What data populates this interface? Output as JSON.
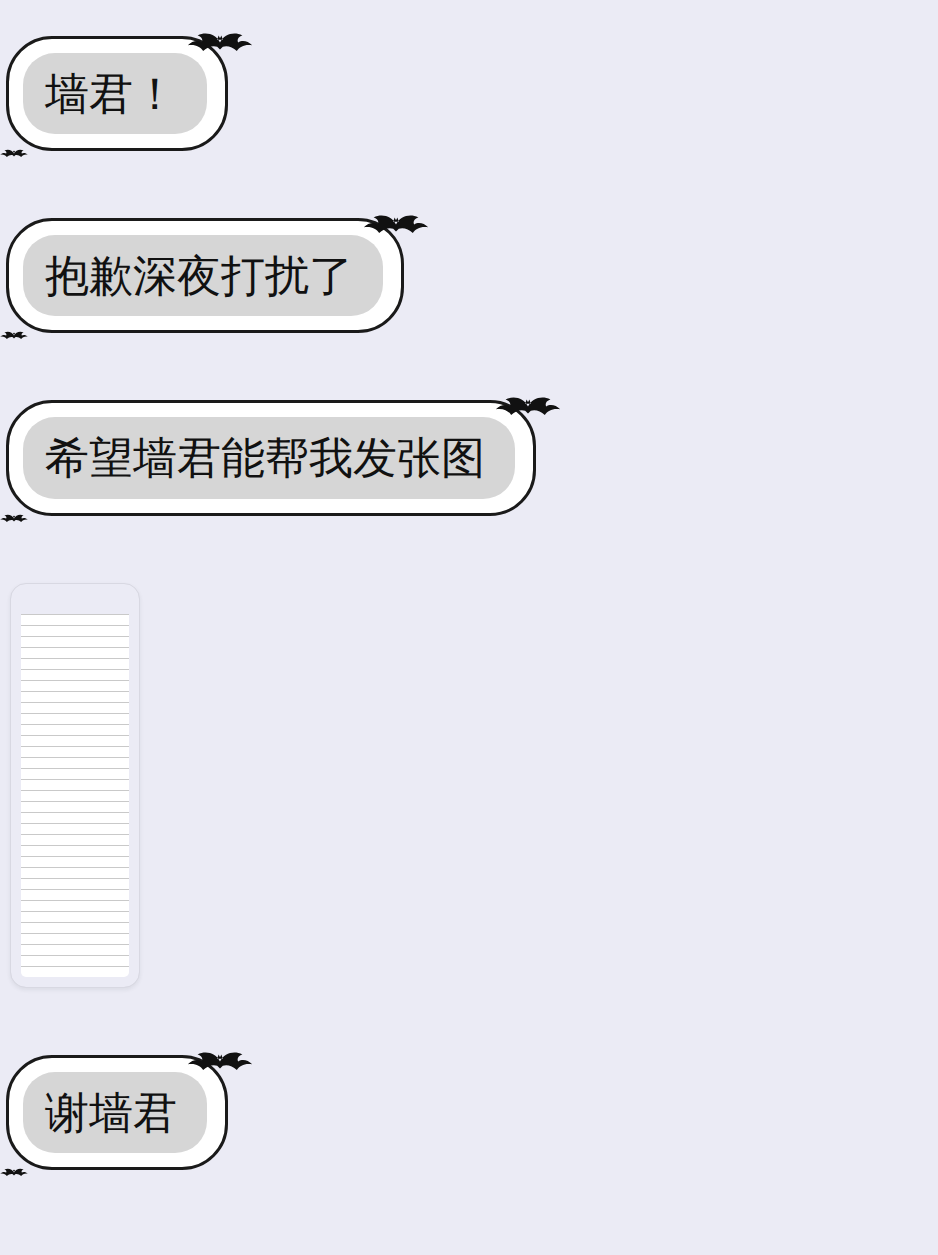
{
  "messages": [
    {
      "kind": "text",
      "text": "墙君！"
    },
    {
      "kind": "text",
      "text": "抱歉深夜打扰了"
    },
    {
      "kind": "text",
      "text": "希望墙君能帮我发张图"
    },
    {
      "kind": "image"
    },
    {
      "kind": "text",
      "text": "谢墙君"
    }
  ]
}
